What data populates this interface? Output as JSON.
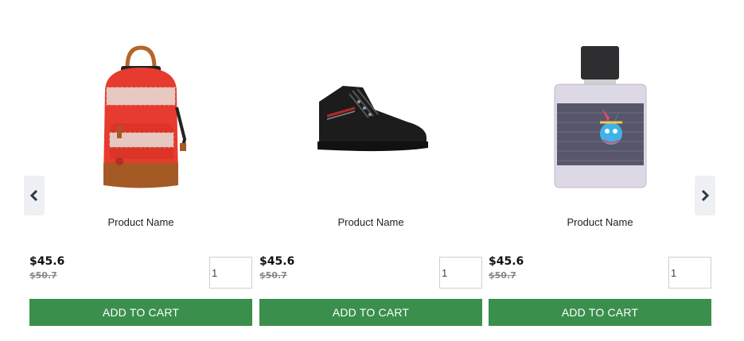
{
  "carousel": {
    "prev_icon": "chevron-left-icon",
    "next_icon": "chevron-right-icon"
  },
  "products": [
    {
      "image": "backpack-image",
      "name": "Product Name",
      "price": "$45.6",
      "old_price": "$50.7",
      "quantity": "1",
      "button_label": "ADD TO CART"
    },
    {
      "image": "boot-image",
      "name": "Product Name",
      "price": "$45.6",
      "old_price": "$50.7",
      "quantity": "1",
      "button_label": "ADD TO CART"
    },
    {
      "image": "perfume-image",
      "name": "Product Name",
      "price": "$45.6",
      "old_price": "$50.7",
      "quantity": "1",
      "button_label": "ADD TO CART"
    }
  ],
  "colors": {
    "button_bg": "#3a8f4d",
    "nav_bg": "#eef0f3",
    "old_price": "#888888"
  }
}
